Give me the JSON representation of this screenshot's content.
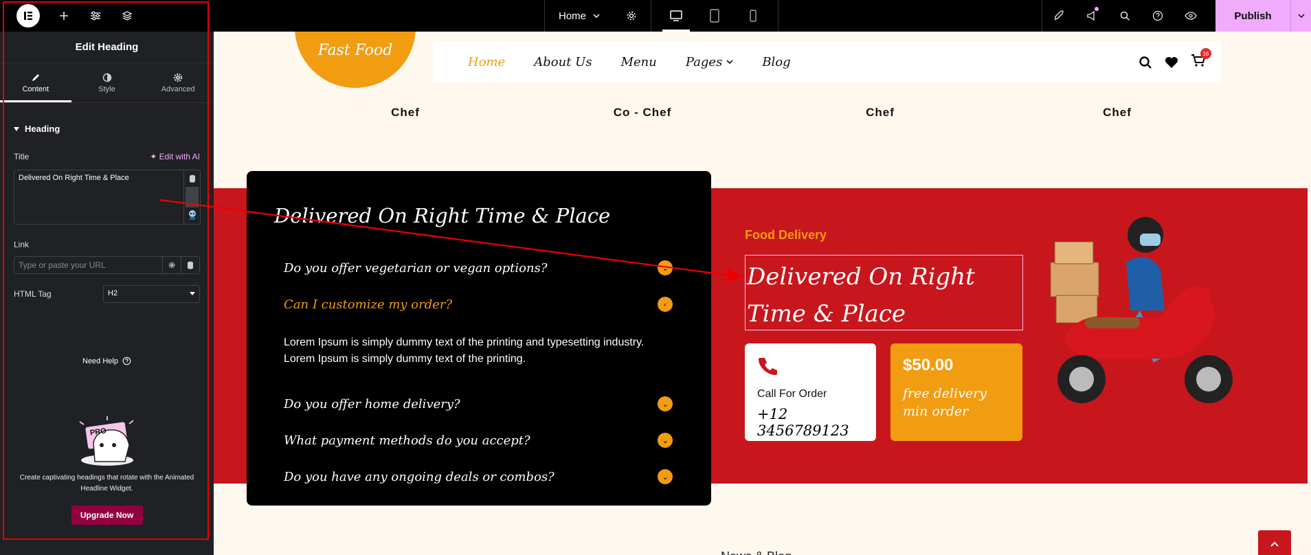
{
  "topbar": {
    "page_name": "Home",
    "publish_label": "Publish"
  },
  "sidebar": {
    "panel_title": "Edit Heading",
    "tabs": [
      {
        "label": "Content"
      },
      {
        "label": "Style"
      },
      {
        "label": "Advanced"
      }
    ],
    "section_heading": "Heading",
    "title_label": "Title",
    "edit_ai_label": "Edit with AI",
    "title_value": "Delivered On Right Time & Place",
    "link_label": "Link",
    "link_placeholder": "Type or paste your URL",
    "html_tag_label": "HTML Tag",
    "html_tag_value": "H2",
    "need_help": "Need Help",
    "promo_badge": "PRO",
    "promo_text": "Create captivating headings that rotate with the Animated Headline Widget.",
    "upgrade_label": "Upgrade Now"
  },
  "site": {
    "logo_text": "Fast Food",
    "nav": [
      {
        "label": "Home"
      },
      {
        "label": "About Us"
      },
      {
        "label": "Menu"
      },
      {
        "label": "Pages"
      },
      {
        "label": "Blog"
      }
    ],
    "cart_count": "16",
    "chefs": [
      "Chef",
      "Co - Chef",
      "Chef",
      "Chef"
    ],
    "faq_title": "Delivered On Right Time & Place",
    "faq": [
      {
        "q": "Do you offer vegetarian or vegan options?"
      },
      {
        "q": "Can I customize my order?"
      },
      {
        "q": "Do you offer home delivery?"
      },
      {
        "q": "What payment methods do you accept?"
      },
      {
        "q": "Do you have any ongoing deals or combos?"
      }
    ],
    "faq_answer": "Lorem Ipsum is simply dummy text of the printing and typesetting industry. Lorem Ipsum is simply dummy text of the printing.",
    "delivery_label": "Food Delivery",
    "delivery_title": "Delivered On Right Time & Place",
    "call_label": "Call For Order",
    "call_number": "+12 3456789123",
    "price": "$50.00",
    "price_desc": "free delivery min order",
    "next_section_title": "News & Blog"
  },
  "colors": {
    "accent": "#f29c11",
    "red": "#c8161d",
    "publish": "#f0abfc",
    "upgrade": "#93003f"
  }
}
